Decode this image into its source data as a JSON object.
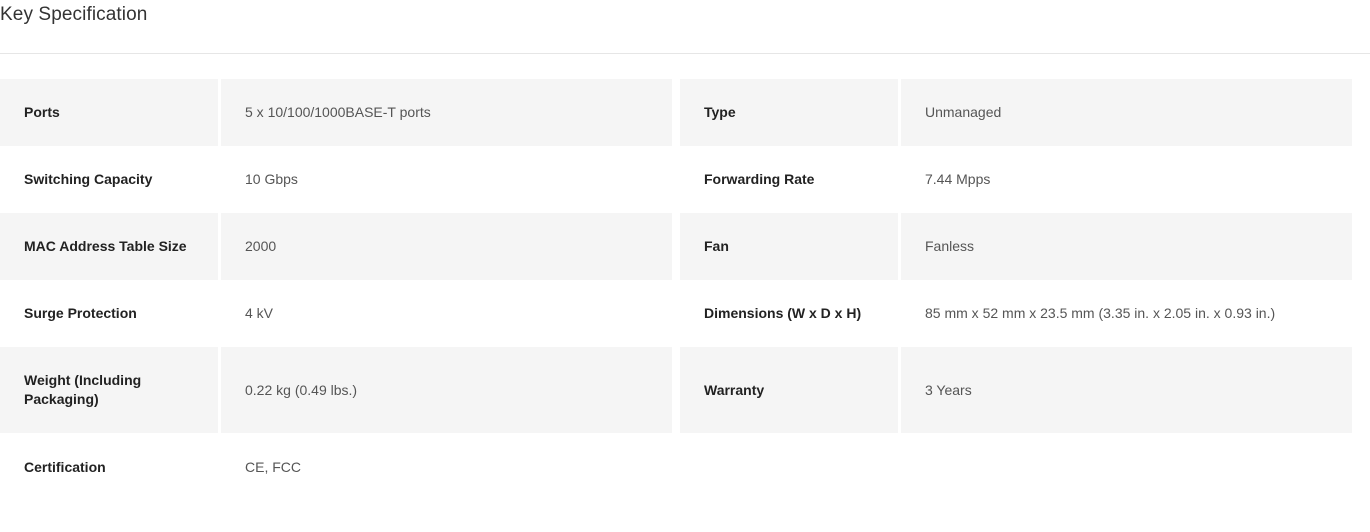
{
  "page": {
    "title": "Key Specification"
  },
  "specs": {
    "rows": [
      {
        "left": {
          "label": "Ports",
          "value": "5 x 10/100/1000BASE-T ports"
        },
        "right": {
          "label": "Type",
          "value": "Unmanaged"
        }
      },
      {
        "left": {
          "label": "Switching Capacity",
          "value": "10 Gbps"
        },
        "right": {
          "label": "Forwarding Rate",
          "value": "7.44 Mpps"
        }
      },
      {
        "left": {
          "label": "MAC Address Table Size",
          "value": "2000"
        },
        "right": {
          "label": "Fan",
          "value": "Fanless"
        }
      },
      {
        "left": {
          "label": "Surge Protection",
          "value": "4 kV"
        },
        "right": {
          "label": "Dimensions (W x D x H)",
          "value": "85 mm x 52 mm x 23.5 mm (3.35 in. x 2.05 in. x 0.93 in.)"
        }
      },
      {
        "left": {
          "label": "Weight (Including Packaging)",
          "value": "0.22 kg (0.49 lbs.)"
        },
        "right": {
          "label": "Warranty",
          "value": "3 Years"
        }
      },
      {
        "left": {
          "label": "Certification",
          "value": "CE, FCC"
        }
      }
    ]
  },
  "colors": {
    "row_stripe": "#f5f5f5",
    "divider": "#e6e6e6",
    "label_text": "#222222",
    "value_text": "#555555"
  }
}
